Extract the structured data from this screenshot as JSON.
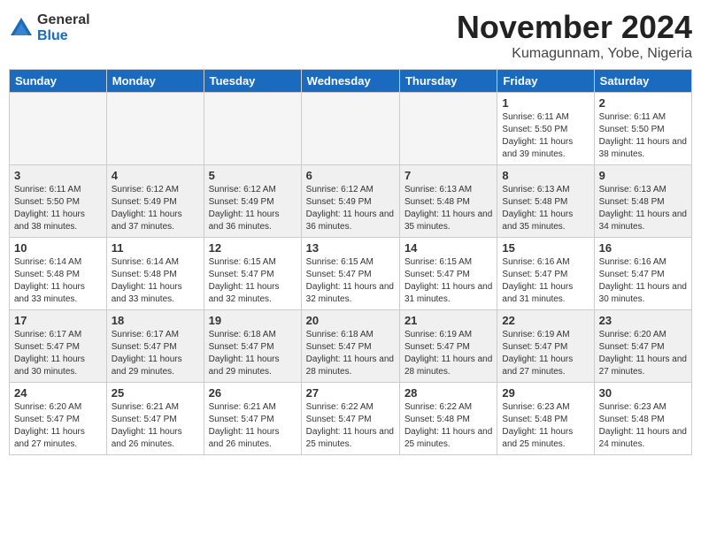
{
  "logo": {
    "general": "General",
    "blue": "Blue"
  },
  "header": {
    "month": "November 2024",
    "location": "Kumagunnam, Yobe, Nigeria"
  },
  "weekdays": [
    "Sunday",
    "Monday",
    "Tuesday",
    "Wednesday",
    "Thursday",
    "Friday",
    "Saturday"
  ],
  "weeks": [
    [
      {
        "day": "",
        "info": ""
      },
      {
        "day": "",
        "info": ""
      },
      {
        "day": "",
        "info": ""
      },
      {
        "day": "",
        "info": ""
      },
      {
        "day": "",
        "info": ""
      },
      {
        "day": "1",
        "info": "Sunrise: 6:11 AM\nSunset: 5:50 PM\nDaylight: 11 hours and 39 minutes."
      },
      {
        "day": "2",
        "info": "Sunrise: 6:11 AM\nSunset: 5:50 PM\nDaylight: 11 hours and 38 minutes."
      }
    ],
    [
      {
        "day": "3",
        "info": "Sunrise: 6:11 AM\nSunset: 5:50 PM\nDaylight: 11 hours and 38 minutes."
      },
      {
        "day": "4",
        "info": "Sunrise: 6:12 AM\nSunset: 5:49 PM\nDaylight: 11 hours and 37 minutes."
      },
      {
        "day": "5",
        "info": "Sunrise: 6:12 AM\nSunset: 5:49 PM\nDaylight: 11 hours and 36 minutes."
      },
      {
        "day": "6",
        "info": "Sunrise: 6:12 AM\nSunset: 5:49 PM\nDaylight: 11 hours and 36 minutes."
      },
      {
        "day": "7",
        "info": "Sunrise: 6:13 AM\nSunset: 5:48 PM\nDaylight: 11 hours and 35 minutes."
      },
      {
        "day": "8",
        "info": "Sunrise: 6:13 AM\nSunset: 5:48 PM\nDaylight: 11 hours and 35 minutes."
      },
      {
        "day": "9",
        "info": "Sunrise: 6:13 AM\nSunset: 5:48 PM\nDaylight: 11 hours and 34 minutes."
      }
    ],
    [
      {
        "day": "10",
        "info": "Sunrise: 6:14 AM\nSunset: 5:48 PM\nDaylight: 11 hours and 33 minutes."
      },
      {
        "day": "11",
        "info": "Sunrise: 6:14 AM\nSunset: 5:48 PM\nDaylight: 11 hours and 33 minutes."
      },
      {
        "day": "12",
        "info": "Sunrise: 6:15 AM\nSunset: 5:47 PM\nDaylight: 11 hours and 32 minutes."
      },
      {
        "day": "13",
        "info": "Sunrise: 6:15 AM\nSunset: 5:47 PM\nDaylight: 11 hours and 32 minutes."
      },
      {
        "day": "14",
        "info": "Sunrise: 6:15 AM\nSunset: 5:47 PM\nDaylight: 11 hours and 31 minutes."
      },
      {
        "day": "15",
        "info": "Sunrise: 6:16 AM\nSunset: 5:47 PM\nDaylight: 11 hours and 31 minutes."
      },
      {
        "day": "16",
        "info": "Sunrise: 6:16 AM\nSunset: 5:47 PM\nDaylight: 11 hours and 30 minutes."
      }
    ],
    [
      {
        "day": "17",
        "info": "Sunrise: 6:17 AM\nSunset: 5:47 PM\nDaylight: 11 hours and 30 minutes."
      },
      {
        "day": "18",
        "info": "Sunrise: 6:17 AM\nSunset: 5:47 PM\nDaylight: 11 hours and 29 minutes."
      },
      {
        "day": "19",
        "info": "Sunrise: 6:18 AM\nSunset: 5:47 PM\nDaylight: 11 hours and 29 minutes."
      },
      {
        "day": "20",
        "info": "Sunrise: 6:18 AM\nSunset: 5:47 PM\nDaylight: 11 hours and 28 minutes."
      },
      {
        "day": "21",
        "info": "Sunrise: 6:19 AM\nSunset: 5:47 PM\nDaylight: 11 hours and 28 minutes."
      },
      {
        "day": "22",
        "info": "Sunrise: 6:19 AM\nSunset: 5:47 PM\nDaylight: 11 hours and 27 minutes."
      },
      {
        "day": "23",
        "info": "Sunrise: 6:20 AM\nSunset: 5:47 PM\nDaylight: 11 hours and 27 minutes."
      }
    ],
    [
      {
        "day": "24",
        "info": "Sunrise: 6:20 AM\nSunset: 5:47 PM\nDaylight: 11 hours and 27 minutes."
      },
      {
        "day": "25",
        "info": "Sunrise: 6:21 AM\nSunset: 5:47 PM\nDaylight: 11 hours and 26 minutes."
      },
      {
        "day": "26",
        "info": "Sunrise: 6:21 AM\nSunset: 5:47 PM\nDaylight: 11 hours and 26 minutes."
      },
      {
        "day": "27",
        "info": "Sunrise: 6:22 AM\nSunset: 5:47 PM\nDaylight: 11 hours and 25 minutes."
      },
      {
        "day": "28",
        "info": "Sunrise: 6:22 AM\nSunset: 5:48 PM\nDaylight: 11 hours and 25 minutes."
      },
      {
        "day": "29",
        "info": "Sunrise: 6:23 AM\nSunset: 5:48 PM\nDaylight: 11 hours and 25 minutes."
      },
      {
        "day": "30",
        "info": "Sunrise: 6:23 AM\nSunset: 5:48 PM\nDaylight: 11 hours and 24 minutes."
      }
    ]
  ]
}
